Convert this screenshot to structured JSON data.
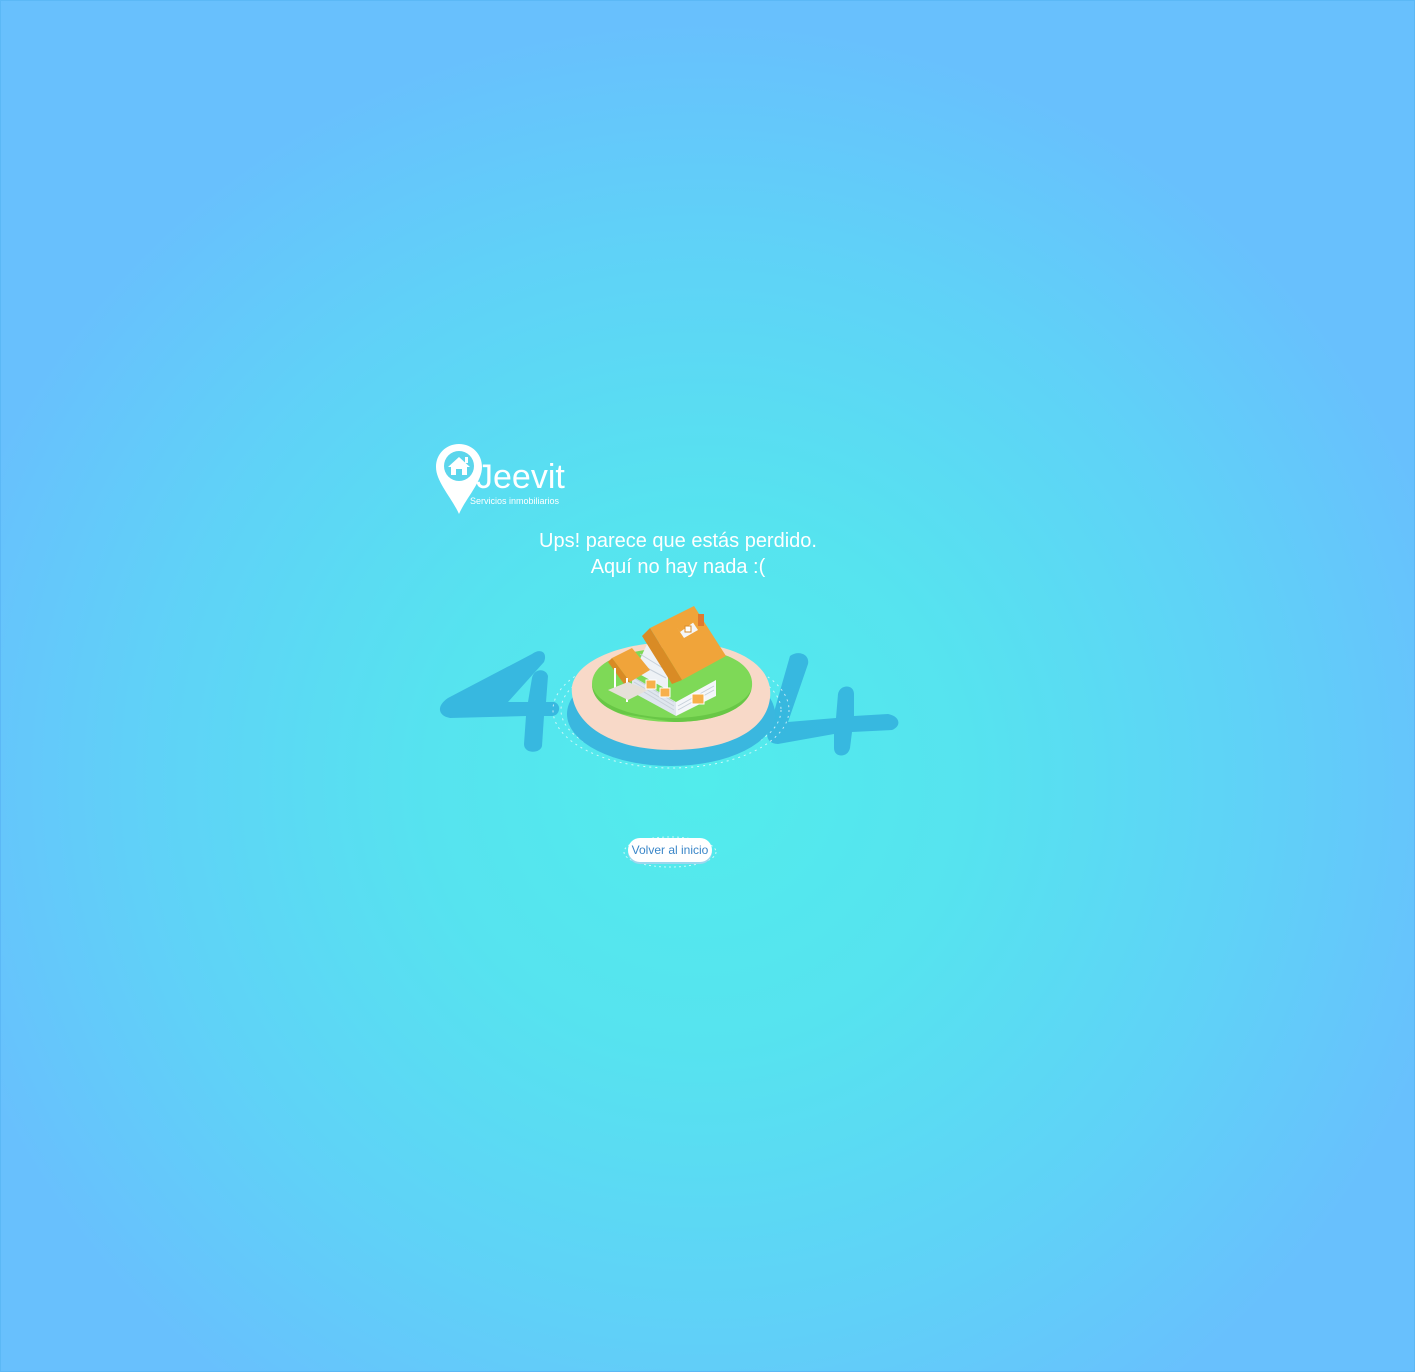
{
  "logo": {
    "brand": "Jeevit",
    "tagline": "Servicios inmobiliarios"
  },
  "message": {
    "line1": "Ups! parece que estás perdido.",
    "line2": "Aquí no hay nada :("
  },
  "illustration": {
    "left_digit": "4",
    "right_digit": "4"
  },
  "button": {
    "label": "Volver al inicio"
  },
  "colors": {
    "background_center": "#52ecec",
    "background_edge": "#68c0fd",
    "digit": "#36b5de",
    "roof": "#f0a43a",
    "grass": "#7ed957",
    "sand": "#f8d9c8",
    "button_text": "#3a86c8"
  }
}
